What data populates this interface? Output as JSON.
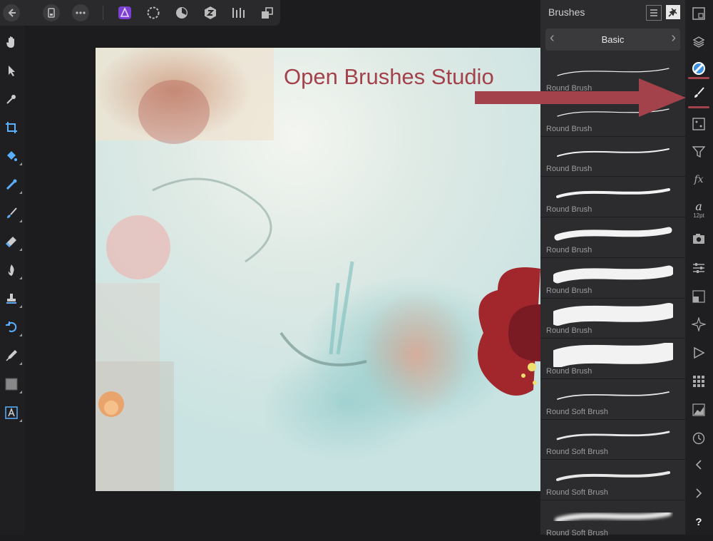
{
  "toolbar": {
    "icons": [
      "back-icon",
      "document-icon",
      "more-icon",
      "photo-persona-icon",
      "liquify-persona-icon",
      "develop-persona-icon",
      "tone-mapping-persona-icon",
      "export-persona-icon",
      "arrange-icon"
    ]
  },
  "left_tools": [
    "view-hand-icon",
    "move-pointer-icon",
    "color-picker-icon",
    "crop-icon",
    "flood-fill-icon",
    "gradient-icon",
    "paint-brush-icon",
    "erase-brush-icon",
    "burn-brush-icon",
    "clone-stamp-icon",
    "undo-brush-icon",
    "pen-icon",
    "rectangle-icon",
    "artistic-text-icon"
  ],
  "brushes_panel": {
    "title": "Brushes",
    "category": "Basic",
    "prev_symbol": "‹",
    "next_symbol": "›",
    "list_view_icon": "list-icon",
    "pin_icon": "pin-icon",
    "items": [
      {
        "name": "Round Brush"
      },
      {
        "name": "Round Brush"
      },
      {
        "name": "Round Brush"
      },
      {
        "name": "Round Brush"
      },
      {
        "name": "Round Brush"
      },
      {
        "name": "Round Brush"
      },
      {
        "name": "Round Brush"
      },
      {
        "name": "Round Brush"
      },
      {
        "name": "Round Soft Brush"
      },
      {
        "name": "Round Soft Brush"
      },
      {
        "name": "Round Soft Brush"
      },
      {
        "name": "Round Soft Brush"
      }
    ]
  },
  "studio_icons": {
    "font_size_label": "12pt",
    "help_label": "?",
    "fx_label": "fx",
    "char_label": "a"
  },
  "annotation": {
    "text": "Open Brushes Studio",
    "color": "#a3424a"
  }
}
